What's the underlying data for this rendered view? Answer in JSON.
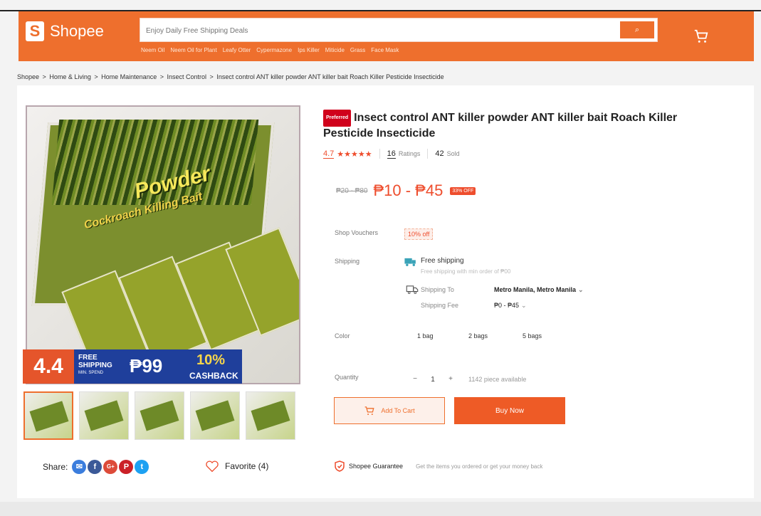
{
  "header": {
    "logo_text": "Shopee",
    "logo_glyph": "S",
    "search_placeholder": "Enjoy Daily Free Shipping Deals",
    "search_button_glyph": "⌕",
    "suggestions": [
      "Neem Oil",
      "Neem Oil for Plant",
      "Leafy Otter",
      "Cypermazone",
      "Ips Killer",
      "Miticide",
      "Grass",
      "Face Mask"
    ]
  },
  "breadcrumb": [
    "Shopee",
    "Home & Living",
    "Home Maintenance",
    "Insect Control",
    "Insect control ANT killer powder ANT killer bait Roach Killer Pesticide Insecticide"
  ],
  "breadcrumb_sep": ">",
  "gallery": {
    "main_text_1": "Powder",
    "main_text_2": "Cockroach Killing Bait",
    "promo": {
      "date": "4.4",
      "free_shipping": "FREE SHIPPING",
      "min_spend": "MIN. SPEND",
      "amount": "₱99",
      "cashback_pct": "10%",
      "cashback_label": "CASHBACK"
    },
    "thumbnail_count": 5
  },
  "share_label": "Share:",
  "social": [
    {
      "name": "messenger",
      "glyph": "✉",
      "color": "#3b7ddd"
    },
    {
      "name": "facebook",
      "glyph": "f",
      "color": "#3b5998"
    },
    {
      "name": "google-plus",
      "glyph": "G+",
      "color": "#dd4b39"
    },
    {
      "name": "pinterest",
      "glyph": "P",
      "color": "#cb2027"
    },
    {
      "name": "twitter",
      "glyph": "t",
      "color": "#1da1f2"
    }
  ],
  "favorite_label": "Favorite (4)",
  "product": {
    "badge": "Preferred",
    "title": "Insect control ANT killer powder ANT killer bait Roach Killer Pesticide Insecticide",
    "rating": "4.7",
    "stars": "★★★★★",
    "ratings_count": "16",
    "ratings_label": "Ratings",
    "sold_count": "42",
    "sold_label": "Sold",
    "price_old": "₱20 - ₱80",
    "price_now": "₱10 - ₱45",
    "discount": "33% OFF"
  },
  "vouchers": {
    "label": "Shop Vouchers",
    "value": "10% off"
  },
  "shipping": {
    "label": "Shipping",
    "free_title": "Free shipping",
    "free_sub": "Free shipping with min order of ₱00",
    "to_label": "Shipping To",
    "to_value": "Metro Manila, Metro Manila",
    "fee_label": "Shipping Fee",
    "fee_value": "₱0 - ₱45"
  },
  "color": {
    "label": "Color",
    "options": [
      "1 bag",
      "2 bags",
      "5 bags"
    ]
  },
  "quantity": {
    "label": "Quantity",
    "minus": "−",
    "value": "1",
    "plus": "+",
    "available": "1142 piece available"
  },
  "buttons": {
    "add_to_cart": "Add To Cart",
    "buy_now": "Buy Now"
  },
  "guarantee": {
    "label": "Shopee Guarantee",
    "sub": "Get the items you ordered or get your money back"
  },
  "colors": {
    "brand": "#ee6f2d",
    "price": "#ee4d2d"
  }
}
